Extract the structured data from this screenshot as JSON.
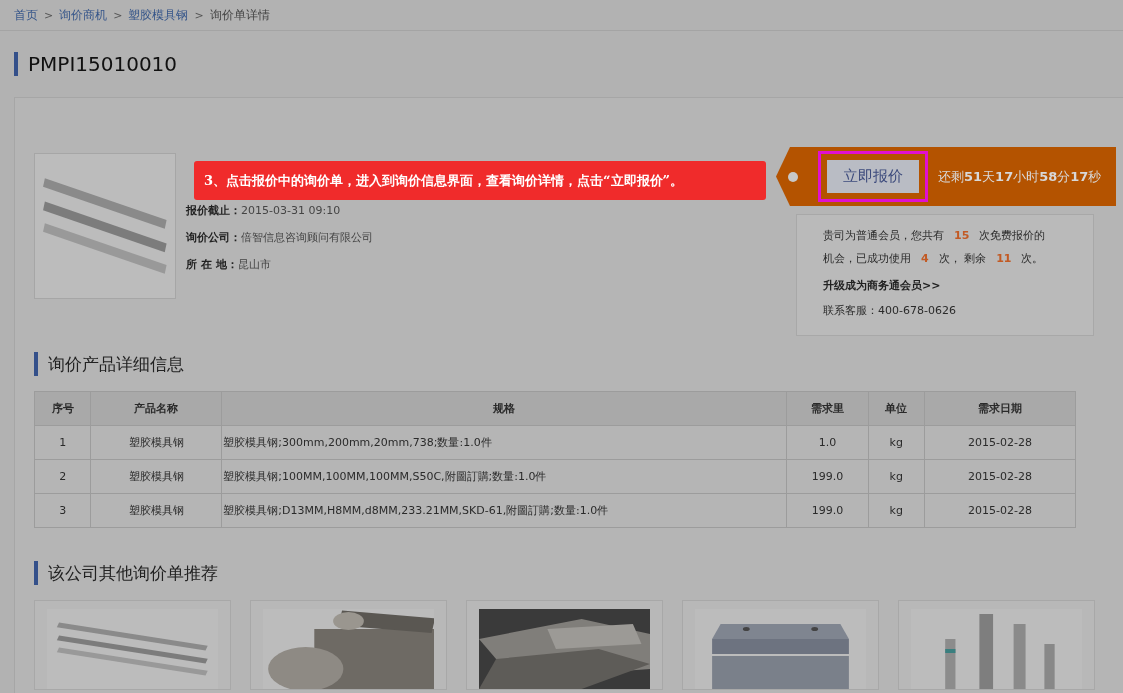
{
  "breadcrumb": [
    {
      "label": "首页",
      "kind": "link"
    },
    {
      "label": "询价商机",
      "kind": "link"
    },
    {
      "label": "塑胶模具钢",
      "kind": "link"
    },
    {
      "label": "询价单详情",
      "kind": "current"
    }
  ],
  "breadcrumb_separator": ">",
  "page_title": "PMPI15010010",
  "inquiry": {
    "fields": [
      {
        "label": "报价截止：",
        "value": "2015-03-31 09:10"
      },
      {
        "label": "询价公司：",
        "value": "倍智信息咨询顾问有限公司"
      },
      {
        "label": "所 在 地：",
        "value": "昆山市"
      }
    ]
  },
  "callout": "3、点击报价中的询价单，进入到询价信息界面，查看询价详情，点击“立即报价”。",
  "quote_button": {
    "label": "立即报价",
    "highlighted": true
  },
  "countdown": "还剩**51**天**17**小时**58**分**17**秒",
  "membership": {
    "line1": [
      {
        "text": "贵司为普通会员，您共有",
        "kind": "plain"
      },
      {
        "text": "15",
        "kind": "number"
      },
      {
        "text": "次免费报价的",
        "kind": "plain"
      }
    ],
    "line2": [
      {
        "text": "机会，已成功使用",
        "kind": "plain"
      },
      {
        "text": "4",
        "kind": "number"
      },
      {
        "text": "次，",
        "kind": "plain"
      },
      {
        "text": "剩余",
        "kind": "plain"
      },
      {
        "text": "11",
        "kind": "number"
      },
      {
        "text": "次。",
        "kind": "plain"
      }
    ],
    "upgrade_link": "升级成为商务通会员>>",
    "service": "联系客服：400-678-0626"
  },
  "products_title": "询价产品详细信息",
  "table": {
    "columns": [
      "序号",
      "产品名称",
      "规格",
      "需求里",
      "单位",
      "需求日期"
    ],
    "rows": [
      [
        "1",
        "塑胶模具钢",
        "塑胶模具钢;300mm,200mm,20mm,738;数量:1.0件",
        "1.0",
        "kg",
        "2015-02-28"
      ],
      [
        "2",
        "塑胶模具钢",
        "塑胶模具钢;100MM,100MM,100MM,S50C,附圖訂購;数量:1.0件",
        "199.0",
        "kg",
        "2015-02-28"
      ],
      [
        "3",
        "塑胶模具钢",
        "塑胶模具钢;D13MM,H8MM,d8MM,233.21MM,SKD-61,附圖訂購;数量:1.0件",
        "199.0",
        "kg",
        "2015-02-28"
      ]
    ]
  },
  "recommend_title": "该公司其他询价单推荐"
}
